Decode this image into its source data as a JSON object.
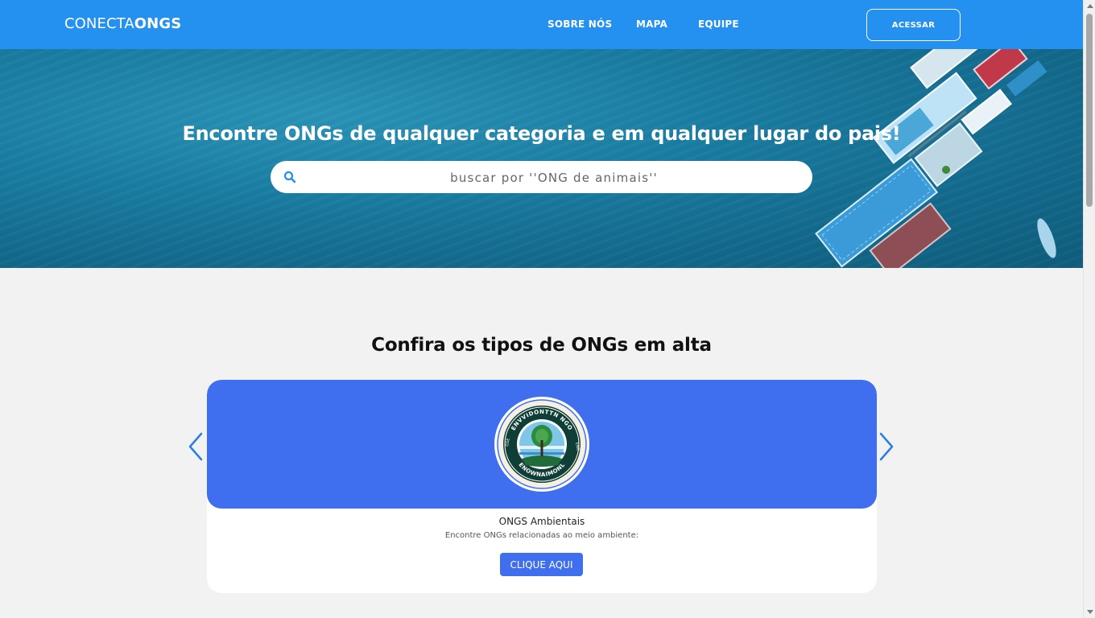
{
  "brand": {
    "prefix": "CONECTA",
    "bold": "ONGS"
  },
  "nav": {
    "links": [
      "SOBRE NÓS",
      "MAPA",
      "EQUIPE"
    ],
    "login_label": "ACESSAR"
  },
  "hero": {
    "title": "Encontre ONGs de qualquer categoria e em qualquer lugar do pais!",
    "search_placeholder": "buscar por ''ONG de animais''"
  },
  "section": {
    "title": "Confira os tipos de ONGs em alta"
  },
  "carousel": {
    "card": {
      "badge_top_text": "ENVVIDONTTN NGO",
      "badge_bottom_text": "ENOWNAIMONL",
      "badge_left_text": "GSE",
      "badge_right_text": "ENG",
      "title": "ONGS Ambientais",
      "description": "Encontre ONGs relacionadas ao meio ambiente:",
      "button_label": "CLIQUE AQUI"
    }
  },
  "colors": {
    "navbar": "#2490f0",
    "card_accent": "#3f6fee",
    "page_bg": "#f2f2f2"
  },
  "icons": [
    "search-icon",
    "chevron-left-icon",
    "chevron-right-icon"
  ]
}
